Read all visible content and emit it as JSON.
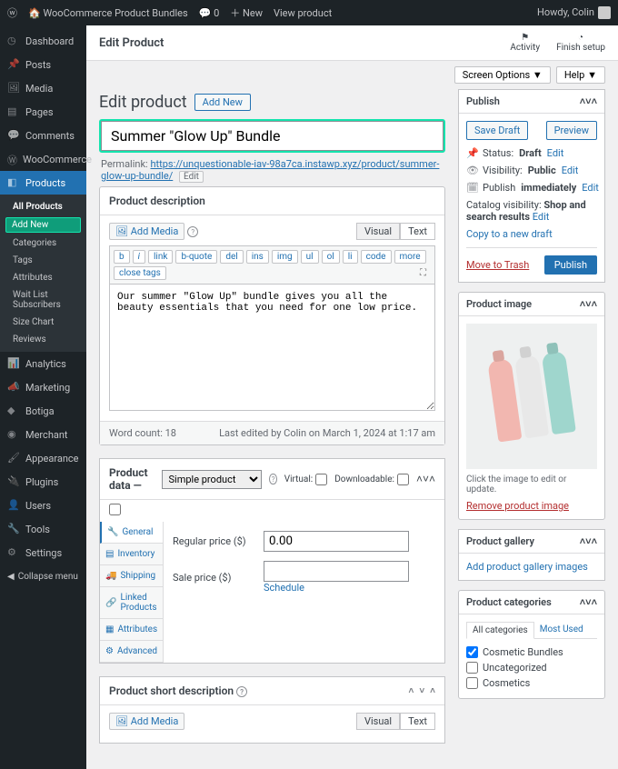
{
  "adminbar": {
    "site": "WooCommerce Product Bundles",
    "comments": "0",
    "new": "New",
    "view": "View product",
    "howdy": "Howdy, Colin"
  },
  "sidebar": {
    "items": [
      {
        "label": "Dashboard"
      },
      {
        "label": "Posts"
      },
      {
        "label": "Media"
      },
      {
        "label": "Pages"
      },
      {
        "label": "Comments"
      },
      {
        "label": "WooCommerce"
      },
      {
        "label": "Products"
      },
      {
        "label": "Analytics"
      },
      {
        "label": "Marketing"
      },
      {
        "label": "Botiga"
      },
      {
        "label": "Merchant"
      },
      {
        "label": "Appearance"
      },
      {
        "label": "Plugins"
      },
      {
        "label": "Users"
      },
      {
        "label": "Tools"
      },
      {
        "label": "Settings"
      }
    ],
    "products_sub": [
      "All Products",
      "Add New",
      "Categories",
      "Tags",
      "Attributes",
      "Wait List Subscribers",
      "Size Chart",
      "Reviews"
    ],
    "collapse": "Collapse menu"
  },
  "topstrip": {
    "title": "Edit Product",
    "activity": "Activity",
    "finish": "Finish setup"
  },
  "screen_opts": {
    "screen": "Screen Options",
    "help": "Help"
  },
  "page": {
    "heading": "Edit product",
    "add_new": "Add New"
  },
  "title_field": {
    "value": "Summer \"Glow Up\" Bundle"
  },
  "permalink": {
    "label": "Permalink:",
    "base": "https://unquestionable-iav-98a7ca.instawp.xyz/product/",
    "slug": "summer-glow-up-bundle/",
    "edit": "Edit"
  },
  "desc": {
    "heading": "Product description",
    "add_media": "Add Media",
    "tabs": {
      "visual": "Visual",
      "text": "Text"
    },
    "toolbar": [
      "b",
      "i",
      "link",
      "b-quote",
      "del",
      "ins",
      "img",
      "ul",
      "ol",
      "li",
      "code",
      "more",
      "close tags"
    ],
    "content": "Our summer \"Glow Up\" bundle gives you all the beauty essentials that you need for one low price.",
    "word_count_label": "Word count:",
    "word_count": "18",
    "last_edit": "Last edited by Colin on March 1, 2024 at 1:17 am"
  },
  "product_data": {
    "heading": "Product data —",
    "type": "Simple product",
    "virtual": "Virtual:",
    "downloadable": "Downloadable:",
    "tabs": [
      "General",
      "Inventory",
      "Shipping",
      "Linked Products",
      "Attributes",
      "Advanced"
    ],
    "regular_label": "Regular price ($)",
    "regular_value": "0.00",
    "sale_label": "Sale price ($)",
    "sale_value": "",
    "schedule": "Schedule"
  },
  "short_desc": {
    "heading": "Product short description",
    "add_media": "Add Media",
    "tabs": {
      "visual": "Visual",
      "text": "Text"
    }
  },
  "publish": {
    "heading": "Publish",
    "save_draft": "Save Draft",
    "preview": "Preview",
    "status_label": "Status:",
    "status_value": "Draft",
    "edit": "Edit",
    "visibility_label": "Visibility:",
    "visibility_value": "Public",
    "publish_label": "Publish",
    "publish_value": "immediately",
    "catalog_label": "Catalog visibility:",
    "catalog_value": "Shop and search results",
    "copy": "Copy to a new draft",
    "trash": "Move to Trash",
    "publish_btn": "Publish"
  },
  "product_image": {
    "heading": "Product image",
    "hint": "Click the image to edit or update.",
    "remove": "Remove product image"
  },
  "gallery": {
    "heading": "Product gallery",
    "add": "Add product gallery images"
  },
  "categories": {
    "heading": "Product categories",
    "tab_all": "All categories",
    "tab_used": "Most Used",
    "items": [
      {
        "label": "Cosmetic Bundles",
        "checked": true
      },
      {
        "label": "Uncategorized",
        "checked": false
      },
      {
        "label": "Cosmetics",
        "checked": false
      }
    ]
  }
}
